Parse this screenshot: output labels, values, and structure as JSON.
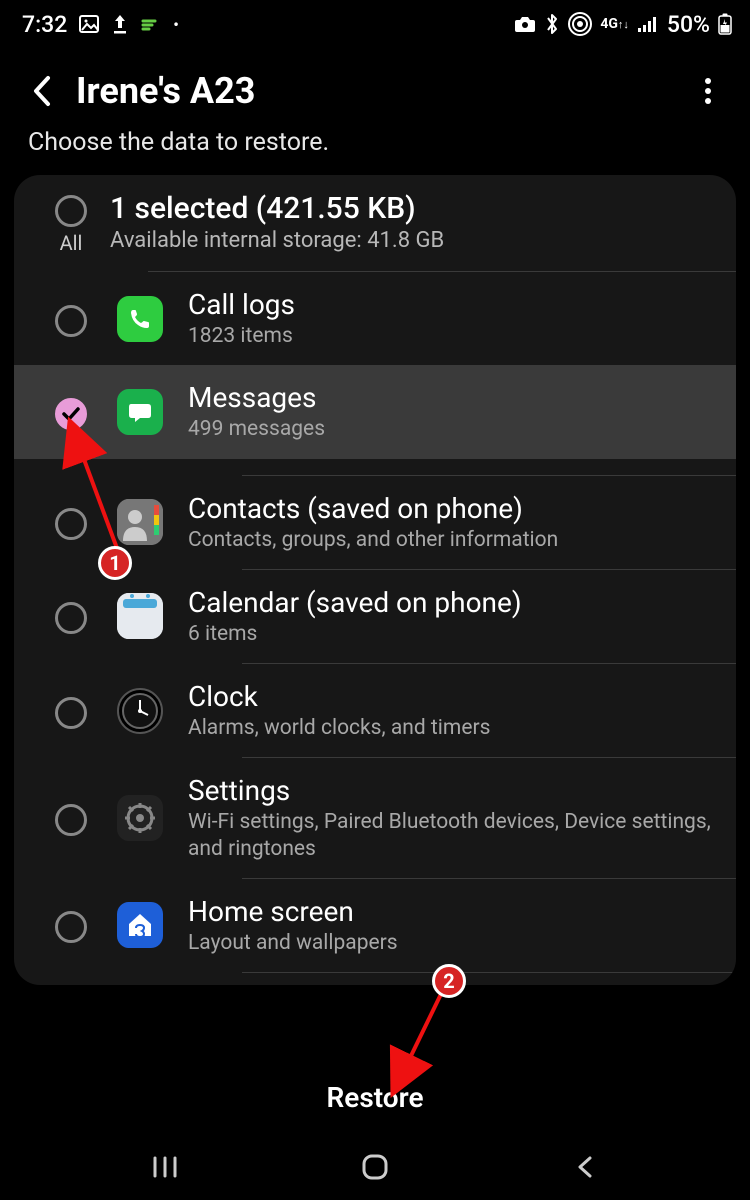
{
  "statusbar": {
    "time": "7:32",
    "network_label": "4G",
    "battery_text": "50%"
  },
  "header": {
    "title": "Irene's A23"
  },
  "subtitle": "Choose the data to restore.",
  "summary": {
    "title": "1 selected (421.55 KB)",
    "subtitle": "Available internal storage: 41.8 GB",
    "all_label": "All"
  },
  "items": [
    {
      "title": "Call logs",
      "subtitle": "1823 items",
      "checked": false
    },
    {
      "title": "Messages",
      "subtitle": "499 messages",
      "checked": true
    },
    {
      "title": "Contacts (saved on phone)",
      "subtitle": "Contacts, groups, and other information",
      "checked": false
    },
    {
      "title": "Calendar (saved on phone)",
      "subtitle": "6 items",
      "checked": false
    },
    {
      "title": "Clock",
      "subtitle": "Alarms, world clocks, and timers",
      "checked": false
    },
    {
      "title": "Settings",
      "subtitle": "Wi-Fi settings, Paired Bluetooth devices, Device settings, and ringtones",
      "checked": false
    },
    {
      "title": "Home screen",
      "subtitle": "Layout and wallpapers",
      "checked": false
    }
  ],
  "restore_button": "Restore",
  "annotations": {
    "badge1": "1",
    "badge2": "2"
  }
}
